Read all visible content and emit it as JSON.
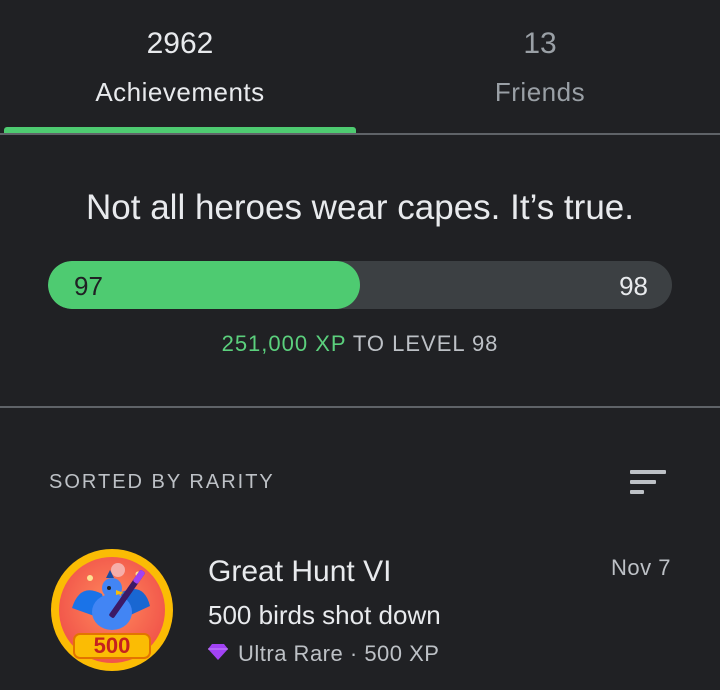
{
  "tabs": [
    {
      "count": "2962",
      "label": "Achievements",
      "active": true
    },
    {
      "count": "13",
      "label": "Friends",
      "active": false
    }
  ],
  "level": {
    "headline": "Not all heroes wear capes. It’s true.",
    "current_level": "97",
    "next_level": "98",
    "progress_fraction": 0.5,
    "xp_amount": "251,000 XP",
    "xp_suffix": " TO LEVEL 98"
  },
  "list": {
    "sort_label": "SORTED BY RARITY",
    "sort_icon": "sort-icon"
  },
  "achievements": [
    {
      "title": "Great Hunt VI",
      "description": "500 birds shot down",
      "rarity": "Ultra Rare",
      "separator": " · ",
      "xp": "500 XP",
      "date": "Nov 7",
      "badge_number": "500",
      "rarity_icon": "diamond-icon",
      "rarity_color": "#a142f4"
    }
  ],
  "colors": {
    "accent": "#4ecb71",
    "background": "#202124",
    "track": "#3c4043",
    "xp_text": "#5bd07d"
  }
}
